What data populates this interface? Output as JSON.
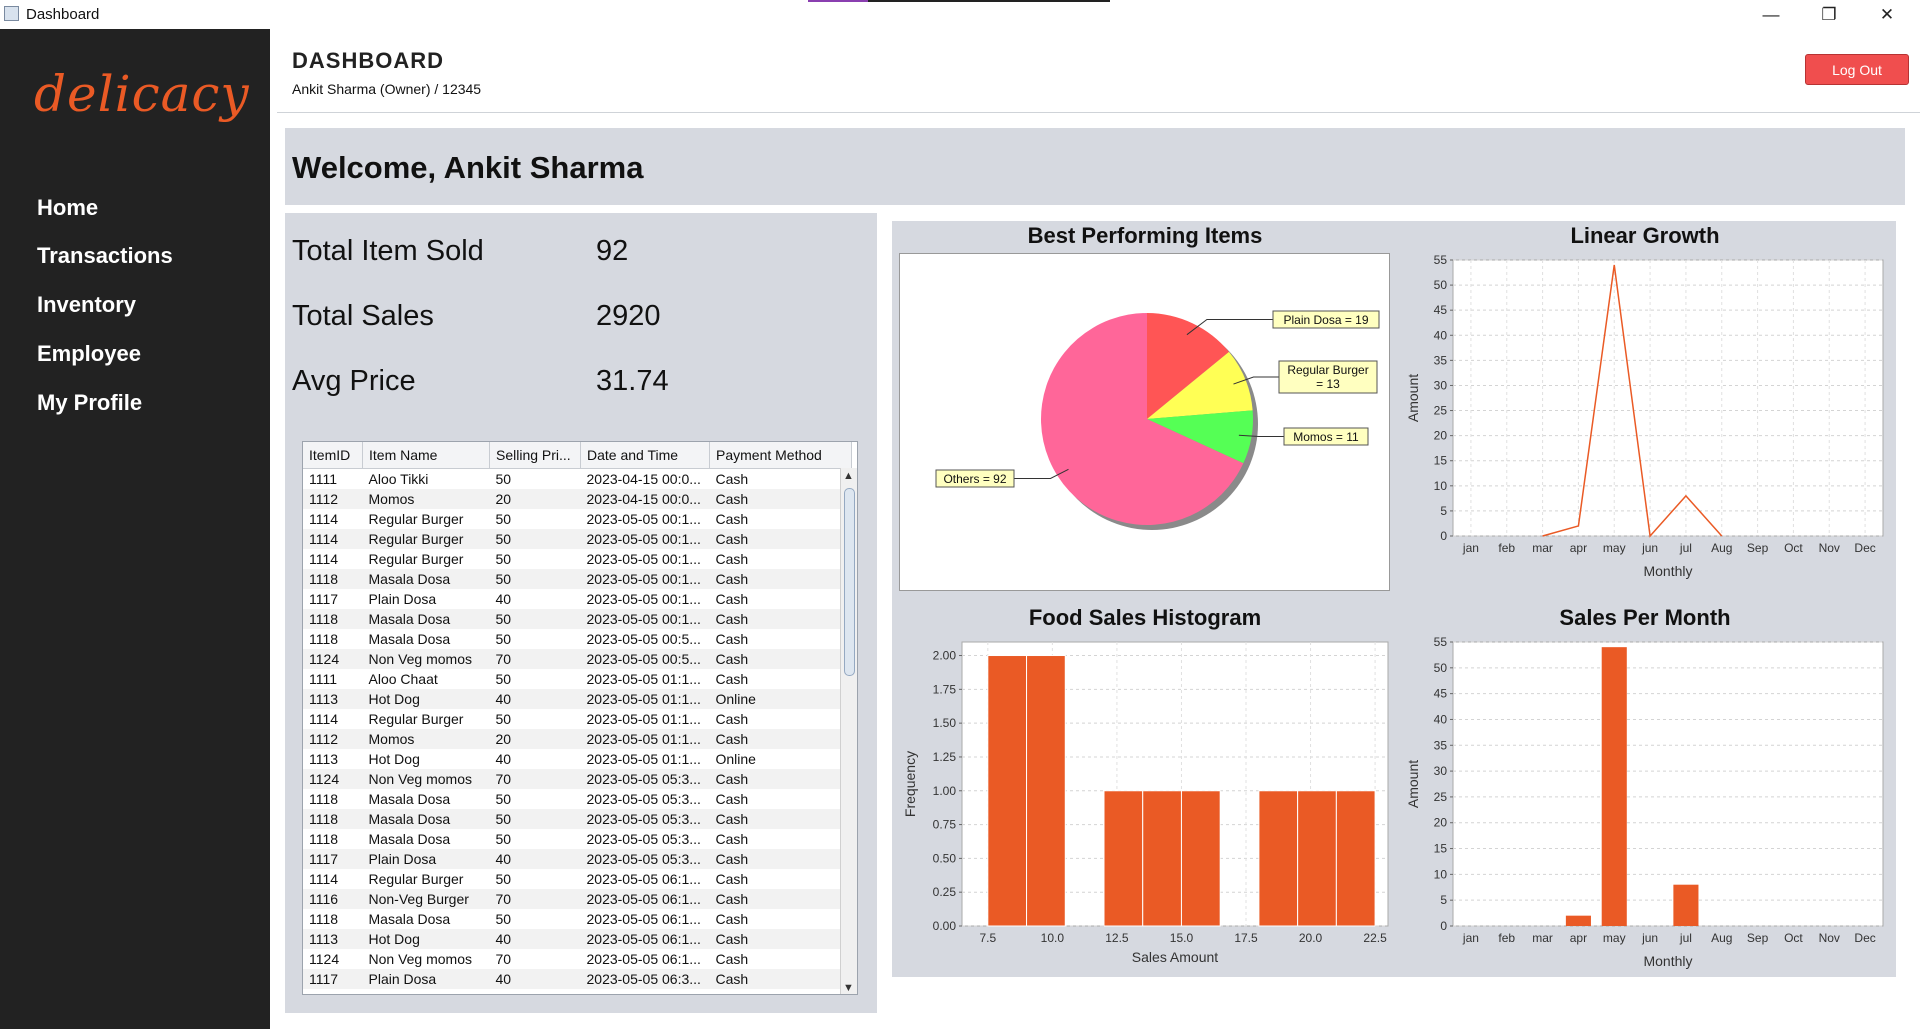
{
  "window": {
    "title": "Dashboard",
    "minimize": "—",
    "restore": "❐",
    "close": "✕"
  },
  "sidebar": {
    "logo": "delicacy",
    "items": [
      {
        "label": "Home"
      },
      {
        "label": "Transactions"
      },
      {
        "label": "Inventory"
      },
      {
        "label": "Employee"
      },
      {
        "label": "My Profile"
      }
    ]
  },
  "header": {
    "title": "DASHBOARD",
    "user": "Ankit Sharma (Owner) / 12345",
    "logout_label": "Log Out"
  },
  "welcome": "Welcome, Ankit Sharma",
  "stats": [
    {
      "label": "Total Item Sold",
      "value": "92"
    },
    {
      "label": "Total Sales",
      "value": "2920"
    },
    {
      "label": "Avg Price",
      "value": "31.74"
    }
  ],
  "table": {
    "columns": [
      "ItemID",
      "Item Name",
      "Selling Pri...",
      "Date and Time",
      "Payment Method"
    ],
    "rows": [
      [
        "1111",
        "Aloo Tikki",
        "50",
        "2023-04-15 00:0...",
        "Cash"
      ],
      [
        "1112",
        "Momos",
        "20",
        "2023-04-15 00:0...",
        "Cash"
      ],
      [
        "1114",
        "Regular Burger",
        "50",
        "2023-05-05 00:1...",
        "Cash"
      ],
      [
        "1114",
        "Regular Burger",
        "50",
        "2023-05-05 00:1...",
        "Cash"
      ],
      [
        "1114",
        "Regular Burger",
        "50",
        "2023-05-05 00:1...",
        "Cash"
      ],
      [
        "1118",
        "Masala Dosa",
        "50",
        "2023-05-05 00:1...",
        "Cash"
      ],
      [
        "1117",
        "Plain Dosa",
        "40",
        "2023-05-05 00:1...",
        "Cash"
      ],
      [
        "1118",
        "Masala Dosa",
        "50",
        "2023-05-05 00:1...",
        "Cash"
      ],
      [
        "1118",
        "Masala Dosa",
        "50",
        "2023-05-05 00:5...",
        "Cash"
      ],
      [
        "1124",
        "Non Veg momos",
        "70",
        "2023-05-05 00:5...",
        "Cash"
      ],
      [
        "1111",
        "Aloo Chaat",
        "50",
        "2023-05-05 01:1...",
        "Cash"
      ],
      [
        "1113",
        "Hot Dog",
        "40",
        "2023-05-05 01:1...",
        "Online"
      ],
      [
        "1114",
        "Regular Burger",
        "50",
        "2023-05-05 01:1...",
        "Cash"
      ],
      [
        "1112",
        "Momos",
        "20",
        "2023-05-05 01:1...",
        "Cash"
      ],
      [
        "1113",
        "Hot Dog",
        "40",
        "2023-05-05 01:1...",
        "Online"
      ],
      [
        "1124",
        "Non Veg momos",
        "70",
        "2023-05-05 05:3...",
        "Cash"
      ],
      [
        "1118",
        "Masala Dosa",
        "50",
        "2023-05-05 05:3...",
        "Cash"
      ],
      [
        "1118",
        "Masala Dosa",
        "50",
        "2023-05-05 05:3...",
        "Cash"
      ],
      [
        "1118",
        "Masala Dosa",
        "50",
        "2023-05-05 05:3...",
        "Cash"
      ],
      [
        "1117",
        "Plain Dosa",
        "40",
        "2023-05-05 05:3...",
        "Cash"
      ],
      [
        "1114",
        "Regular Burger",
        "50",
        "2023-05-05 06:1...",
        "Cash"
      ],
      [
        "1116",
        "Non-Veg Burger",
        "70",
        "2023-05-05 06:1...",
        "Cash"
      ],
      [
        "1118",
        "Masala Dosa",
        "50",
        "2023-05-05 06:1...",
        "Cash"
      ],
      [
        "1113",
        "Hot Dog",
        "40",
        "2023-05-05 06:1...",
        "Cash"
      ],
      [
        "1124",
        "Non Veg momos",
        "70",
        "2023-05-05 06:1...",
        "Cash"
      ],
      [
        "1117",
        "Plain Dosa",
        "40",
        "2023-05-05 06:3...",
        "Cash"
      ]
    ]
  },
  "chart_data": [
    {
      "type": "pie",
      "title": "Best Performing Items",
      "slices": [
        {
          "label": "Plain Dosa = 19",
          "value": 19,
          "color": "#ff5555"
        },
        {
          "label": "Regular Burger = 13",
          "value": 13,
          "color": "#ffff55"
        },
        {
          "label": "Momos = 11",
          "value": 11,
          "color": "#55ff55"
        },
        {
          "label": "Others = 92",
          "value": 92,
          "color": "#ff6699"
        }
      ]
    },
    {
      "type": "line",
      "title": "Linear Growth",
      "xlabel": "Monthly",
      "ylabel": "Amount",
      "categories": [
        "jan",
        "feb",
        "mar",
        "apr",
        "may",
        "jun",
        "jul",
        "Aug",
        "Sep",
        "Oct",
        "Nov",
        "Dec"
      ],
      "values": [
        null,
        null,
        0,
        2,
        54,
        0,
        8,
        0,
        null,
        null,
        null,
        null
      ],
      "ylim": [
        0,
        55
      ],
      "yticks": [
        0,
        5,
        10,
        15,
        20,
        25,
        30,
        35,
        40,
        45,
        50,
        55
      ],
      "color": "#ea5a25"
    },
    {
      "type": "bar",
      "title": "Food Sales Histogram",
      "xlabel": "Sales Amount",
      "ylabel": "Frequency",
      "bins": [
        {
          "from": 7.5,
          "to": 9.0,
          "value": 2
        },
        {
          "from": 9.0,
          "to": 10.5,
          "value": 2
        },
        {
          "from": 12.0,
          "to": 13.5,
          "value": 1
        },
        {
          "from": 13.5,
          "to": 15.0,
          "value": 1
        },
        {
          "from": 15.0,
          "to": 16.5,
          "value": 1
        },
        {
          "from": 18.0,
          "to": 19.5,
          "value": 1
        },
        {
          "from": 19.5,
          "to": 21.0,
          "value": 1
        },
        {
          "from": 21.0,
          "to": 22.5,
          "value": 1
        }
      ],
      "xlim": [
        6.5,
        23.0
      ],
      "xticks": [
        "7.5",
        "10.0",
        "12.5",
        "15.0",
        "17.5",
        "20.0",
        "22.5"
      ],
      "ylim": [
        0,
        2.1
      ],
      "yticks": [
        "0.00",
        "0.25",
        "0.50",
        "0.75",
        "1.00",
        "1.25",
        "1.50",
        "1.75",
        "2.00"
      ],
      "color": "#ea5a25"
    },
    {
      "type": "bar",
      "title": "Sales Per Month",
      "xlabel": "Monthly",
      "ylabel": "Amount",
      "categories": [
        "jan",
        "feb",
        "mar",
        "apr",
        "may",
        "jun",
        "jul",
        "Aug",
        "Sep",
        "Oct",
        "Nov",
        "Dec"
      ],
      "values": [
        0,
        0,
        0,
        2,
        54,
        0,
        8,
        0,
        0,
        0,
        0,
        0
      ],
      "ylim": [
        0,
        55
      ],
      "yticks": [
        0,
        5,
        10,
        15,
        20,
        25,
        30,
        35,
        40,
        45,
        50,
        55
      ],
      "color": "#ea5a25"
    }
  ]
}
